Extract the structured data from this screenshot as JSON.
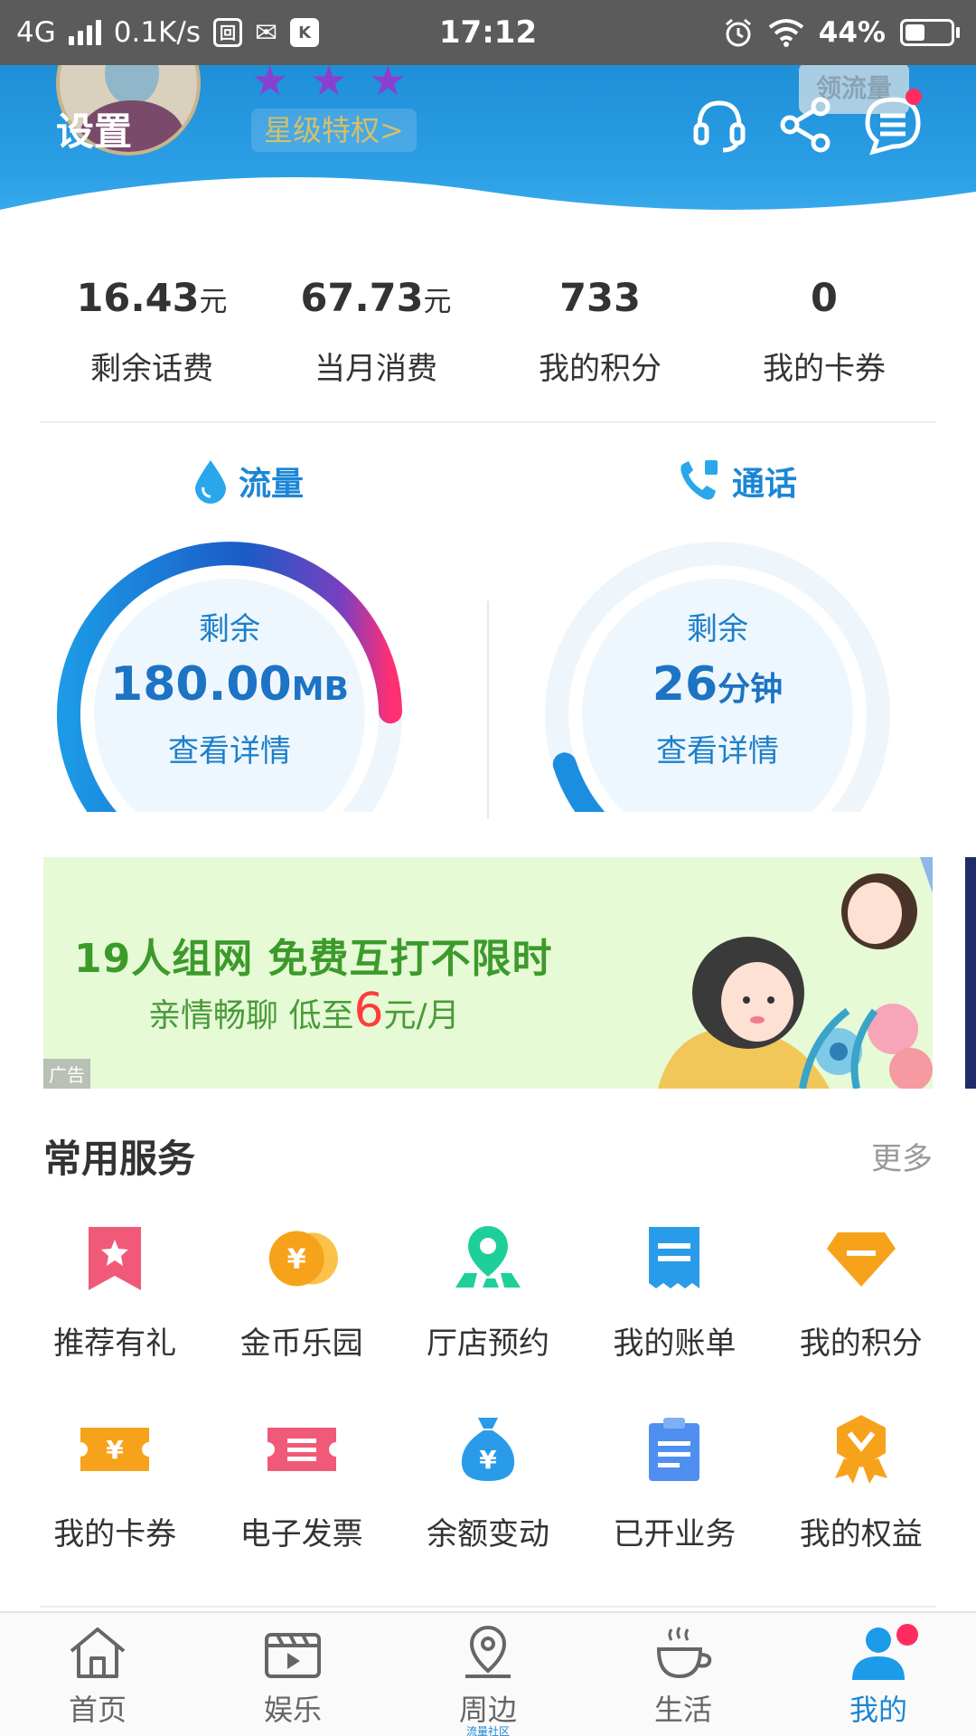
{
  "status_bar": {
    "network": "4G",
    "speed": "0.1K/s",
    "time": "17:12",
    "battery": "44%",
    "battery_fraction": 0.44
  },
  "header": {
    "settings_label": "设置",
    "stars": [
      "★",
      "★",
      "★"
    ],
    "privilege_label": "星级特权>",
    "flow_badge": "领流量"
  },
  "stats": [
    {
      "value": "16.43",
      "unit": "元",
      "label": "剩余话费"
    },
    {
      "value": "67.73",
      "unit": "元",
      "label": "当月消费"
    },
    {
      "value": "733",
      "unit": "",
      "label": "我的积分"
    },
    {
      "value": "0",
      "unit": "",
      "label": "我的卡券"
    }
  ],
  "data_gauge": {
    "title": "流量",
    "remaining_label": "剩余",
    "value": "180.00",
    "unit": "MB",
    "detail_label": "查看详情",
    "fill_fraction": 1.0
  },
  "call_gauge": {
    "title": "通话",
    "remaining_label": "剩余",
    "value": "26",
    "unit": "分钟",
    "detail_label": "查看详情",
    "fill_fraction": 0.12
  },
  "banner": {
    "headline": "19人组网 免费互打不限时",
    "sub_before": "亲情畅聊 低至",
    "sub_highlight": "6",
    "sub_after": "元/月",
    "ad_tag": "广告"
  },
  "services": {
    "title": "常用服务",
    "more": "更多",
    "items": [
      {
        "label": "推荐有礼",
        "icon": "gift-bookmark-icon",
        "color": "#f05a78"
      },
      {
        "label": "金币乐园",
        "icon": "gold-coin-icon",
        "color": "#f7a21b"
      },
      {
        "label": "厅店预约",
        "icon": "store-location-icon",
        "color": "#1fcf9a"
      },
      {
        "label": "我的账单",
        "icon": "bill-icon",
        "color": "#2a9be8"
      },
      {
        "label": "我的积分",
        "icon": "diamond-points-icon",
        "color": "#f7a21b"
      },
      {
        "label": "我的卡券",
        "icon": "coupon-ticket-icon",
        "color": "#f7a21b"
      },
      {
        "label": "电子发票",
        "icon": "invoice-icon",
        "color": "#f05a78"
      },
      {
        "label": "余额变动",
        "icon": "money-bag-icon",
        "color": "#2a9be8"
      },
      {
        "label": "已开业务",
        "icon": "clipboard-icon",
        "color": "#4f8ff0"
      },
      {
        "label": "我的权益",
        "icon": "medal-icon",
        "color": "#f7a21b"
      }
    ]
  },
  "tabbar": {
    "items": [
      {
        "label": "首页",
        "icon": "home-icon",
        "active": false
      },
      {
        "label": "娱乐",
        "icon": "video-clapper-icon",
        "active": false
      },
      {
        "label": "周边",
        "icon": "map-pin-icon",
        "active": false,
        "sub": "流量社区"
      },
      {
        "label": "生活",
        "icon": "coffee-cup-icon",
        "active": false
      },
      {
        "label": "我的",
        "icon": "user-icon",
        "active": true
      }
    ]
  },
  "colors": {
    "brand_blue": "#1b86d5",
    "header_blue": "#2b9fe6",
    "accent_red": "#ff2d5f"
  }
}
